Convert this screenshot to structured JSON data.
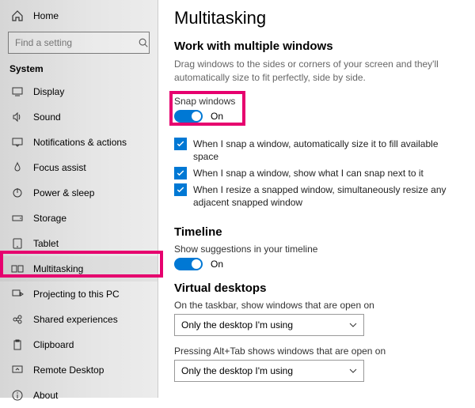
{
  "home_label": "Home",
  "search_placeholder": "Find a setting",
  "section_label": "System",
  "nav": [
    "Display",
    "Sound",
    "Notifications & actions",
    "Focus assist",
    "Power & sleep",
    "Storage",
    "Tablet",
    "Multitasking",
    "Projecting to this PC",
    "Shared experiences",
    "Clipboard",
    "Remote Desktop",
    "About"
  ],
  "page_title": "Multitasking",
  "sec1_title": "Work with multiple windows",
  "sec1_desc": "Drag windows to the sides or corners of your screen and they'll automatically size to fit perfectly, side by side.",
  "snap_label": "Snap windows",
  "snap_state": "On",
  "chk1": "When I snap a window, automatically size it to fill available space",
  "chk2": "When I snap a window, show what I can snap next to it",
  "chk3": "When I resize a snapped window, simultaneously resize any adjacent snapped window",
  "sec2_title": "Timeline",
  "timeline_label": "Show suggestions in your timeline",
  "timeline_state": "On",
  "sec3_title": "Virtual desktops",
  "vd1_label": "On the taskbar, show windows that are open on",
  "vd1_value": "Only the desktop I'm using",
  "vd2_label": "Pressing Alt+Tab shows windows that are open on",
  "vd2_value": "Only the desktop I'm using"
}
